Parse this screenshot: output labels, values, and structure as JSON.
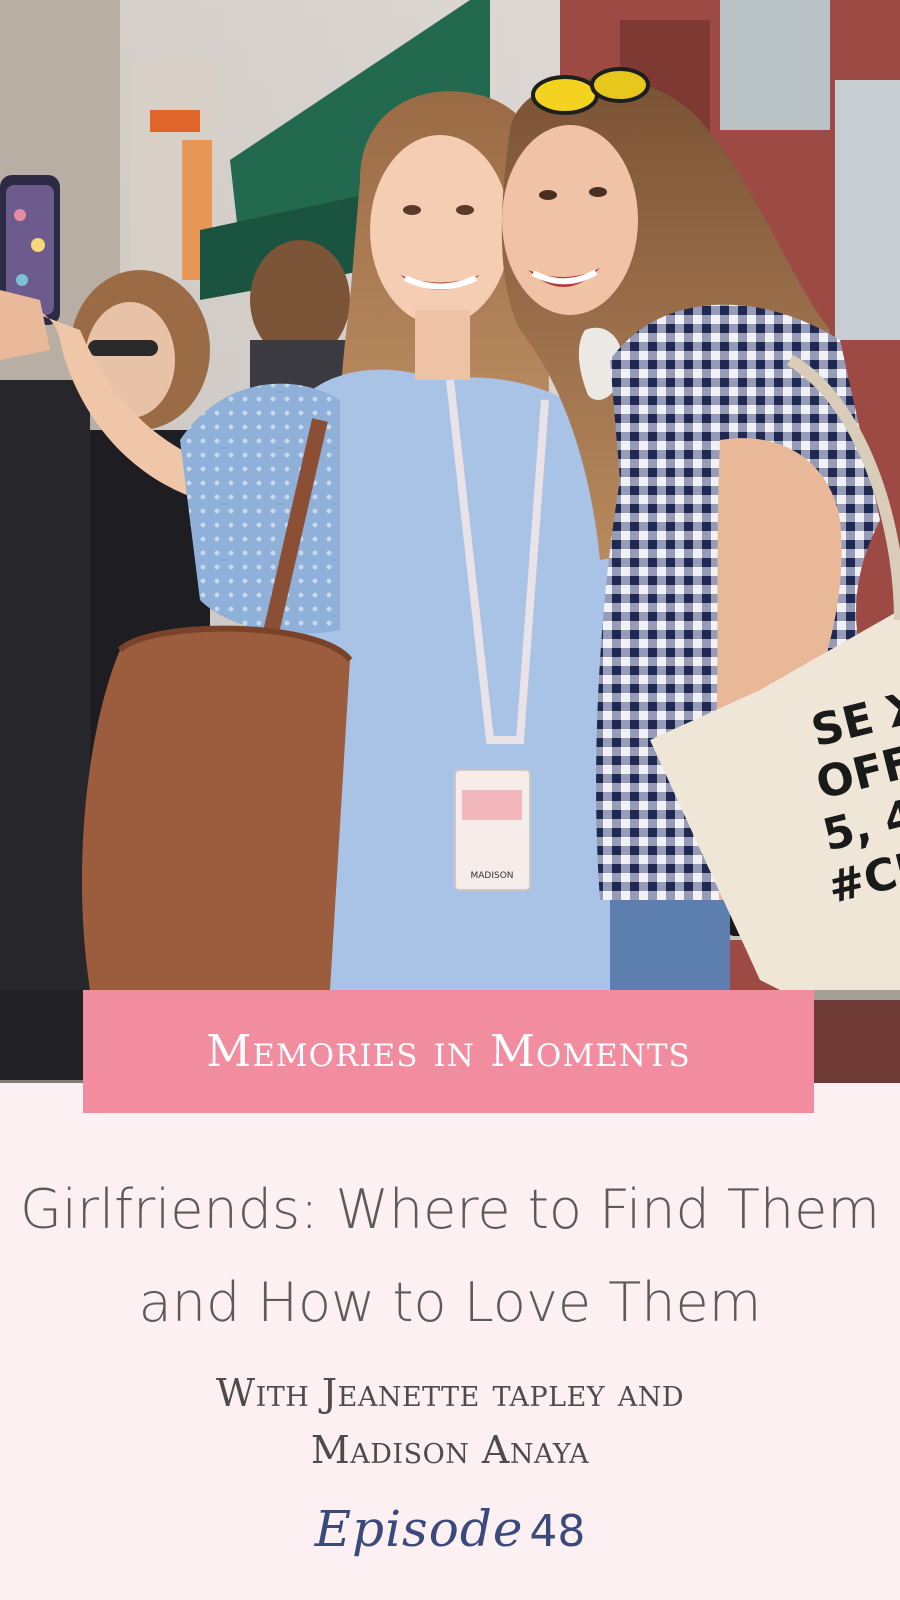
{
  "banner": {
    "title": "Memories in Moments"
  },
  "episode": {
    "title": "Girlfriends: Where to Find Them and How to Love Them",
    "hosts_line1": "With Jeanette tapley and",
    "hosts_line2": "Madison Anaya",
    "label": "Episode",
    "number": "48"
  },
  "colors": {
    "background": "#fcf0f3",
    "banner": "#f28da0",
    "episode_label": "#3a4a7c",
    "title_text": "#5e5a5b"
  },
  "photo": {
    "badge_text": "MADISON",
    "tote_lines": [
      "SE X",
      "OFF",
      "5, 4,",
      "#CI"
    ]
  }
}
